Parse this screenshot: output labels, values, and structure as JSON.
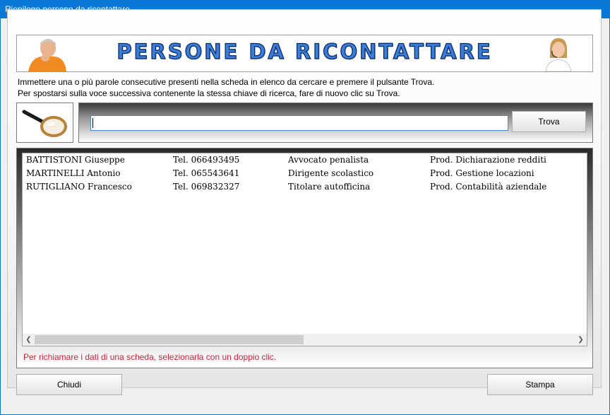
{
  "window": {
    "title": "Riepilogo persone da ricontattare"
  },
  "banner": {
    "title": "PERSONE DA RICONTATTARE"
  },
  "instructions": {
    "line1": "Immettere una o più parole consecutive presenti nella scheda in elenco da cercare e premere il pulsante Trova.",
    "line2": "Per spostarsi sulla voce successiva contenente la stessa chiave di ricerca, fare di nuovo clic su Trova."
  },
  "search": {
    "value": "",
    "button_label": "Trova"
  },
  "list": {
    "rows": [
      {
        "name": "BATTISTONI Giuseppe",
        "phone": "Tel. 066493495",
        "role": "Avvocato penalista",
        "product": "Prod. Dichiarazione redditi"
      },
      {
        "name": "MARTINELLI Antonio",
        "phone": "Tel. 065543641",
        "role": "Dirigente scolastico",
        "product": "Prod. Gestione locazioni"
      },
      {
        "name": "RUTIGLIANO Francesco",
        "phone": "Tel. 069832327",
        "role": "Titolare autofficina",
        "product": "Prod. Contabilità aziendale"
      }
    ]
  },
  "hint": "Per richiamare i dati di una scheda, selezionarla con un doppio clic.",
  "footer": {
    "close_label": "Chiudi",
    "print_label": "Stampa"
  },
  "colors": {
    "titlebar": "#0a78d7",
    "hint": "#d4213a",
    "banner_text": "#3a7fd5"
  }
}
